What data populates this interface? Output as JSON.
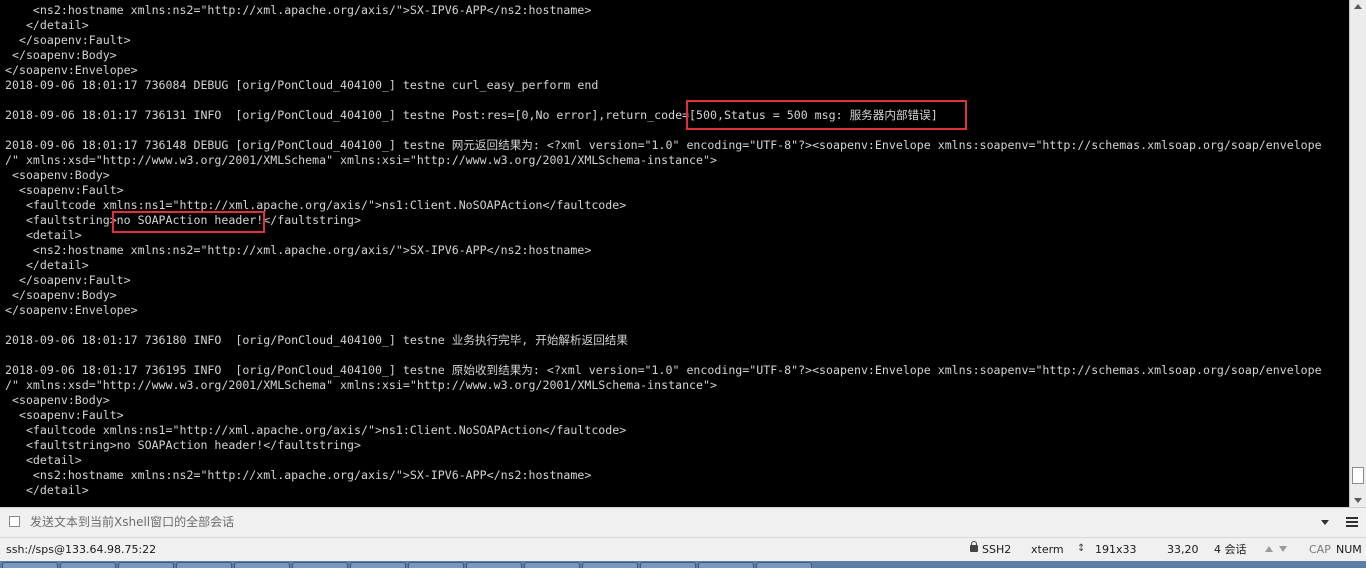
{
  "terminal": {
    "background": "#000000",
    "foreground": "#d4d4d4",
    "highlight_color": "#e0303a",
    "lines": [
      "    <ns2:hostname xmlns:ns2=\"http://xml.apache.org/axis/\">SX-IPV6-APP</ns2:hostname>",
      "   </detail>",
      "  </soapenv:Fault>",
      " </soapenv:Body>",
      "</soapenv:Envelope>",
      "2018-09-06 18:01:17 736084 DEBUG [orig/PonCloud_404100_] testne curl_easy_perform end",
      "",
      "2018-09-06 18:01:17 736131 INFO  [orig/PonCloud_404100_] testne Post:res=[0,No error],return_code=[500,Status = 500 msg: 服务器内部错误]",
      "",
      "2018-09-06 18:01:17 736148 DEBUG [orig/PonCloud_404100_] testne 网元返回结果为: <?xml version=\"1.0\" encoding=\"UTF-8\"?><soapenv:Envelope xmlns:soapenv=\"http://schemas.xmlsoap.org/soap/envelope",
      "/\" xmlns:xsd=\"http://www.w3.org/2001/XMLSchema\" xmlns:xsi=\"http://www.w3.org/2001/XMLSchema-instance\">",
      " <soapenv:Body>",
      "  <soapenv:Fault>",
      "   <faultcode xmlns:ns1=\"http://xml.apache.org/axis/\">ns1:Client.NoSOAPAction</faultcode>",
      "   <faultstring>no SOAPAction header!</faultstring>",
      "   <detail>",
      "    <ns2:hostname xmlns:ns2=\"http://xml.apache.org/axis/\">SX-IPV6-APP</ns2:hostname>",
      "   </detail>",
      "  </soapenv:Fault>",
      " </soapenv:Body>",
      "</soapenv:Envelope>",
      "",
      "2018-09-06 18:01:17 736180 INFO  [orig/PonCloud_404100_] testne 业务执行完毕, 开始解析返回结果",
      "",
      "2018-09-06 18:01:17 736195 INFO  [orig/PonCloud_404100_] testne 原始收到结果为: <?xml version=\"1.0\" encoding=\"UTF-8\"?><soapenv:Envelope xmlns:soapenv=\"http://schemas.xmlsoap.org/soap/envelope",
      "/\" xmlns:xsd=\"http://www.w3.org/2001/XMLSchema\" xmlns:xsi=\"http://www.w3.org/2001/XMLSchema-instance\">",
      " <soapenv:Body>",
      "  <soapenv:Fault>",
      "   <faultcode xmlns:ns1=\"http://xml.apache.org/axis/\">ns1:Client.NoSOAPAction</faultcode>",
      "   <faultstring>no SOAPAction header!</faultstring>",
      "   <detail>",
      "    <ns2:hostname xmlns:ns2=\"http://xml.apache.org/axis/\">SX-IPV6-APP</ns2:hostname>",
      "   </detail>"
    ]
  },
  "compose_bar": {
    "checkbox_icon": "checkbox-icon",
    "text": "发送文本到当前Xshell窗口的全部会话",
    "dropdown_icon": "chevron-down-icon",
    "menu_icon": "menu-icon"
  },
  "status_bar": {
    "connection": "ssh://sps@133.64.98.75:22",
    "protocol": "SSH2",
    "terminal_type": "xterm",
    "size": "191x33",
    "cursor": "33,20",
    "sessions": "4 会话",
    "caps": "CAP",
    "num": "NUM"
  }
}
